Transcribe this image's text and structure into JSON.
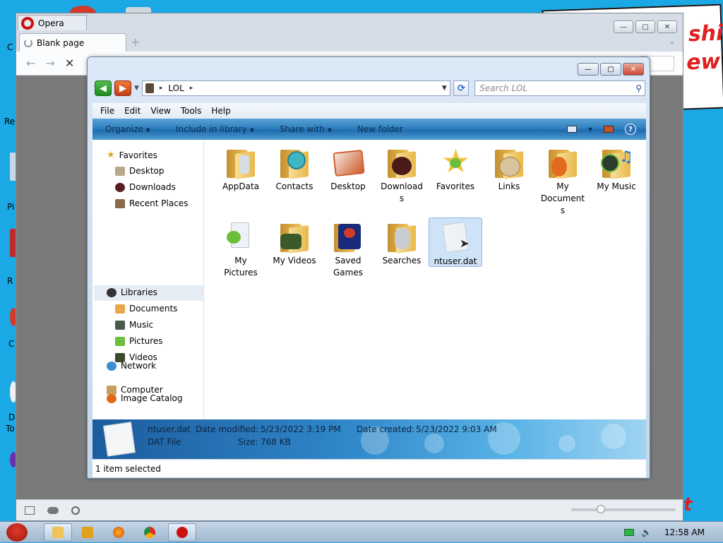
{
  "desktop": {
    "labels": [
      "C",
      "Re",
      "Pi",
      "R",
      "C",
      "D",
      "To"
    ],
    "comic_text_1": "shi",
    "comic_text_2": "ew",
    "comic_text_3": "t"
  },
  "opera": {
    "title": "Opera",
    "tab_label": "Blank page",
    "add_tab": "+",
    "nav": {
      "back": "←",
      "forward": "→",
      "stop": "✕"
    },
    "win_buttons": {
      "minimize": "—",
      "maximize": "▢",
      "close": "✕"
    },
    "tab_menu_chevron": "⌄"
  },
  "explorer": {
    "win_buttons": {
      "minimize": "—",
      "maximize": "▢",
      "close": "✕"
    },
    "address": {
      "segment": "LOL",
      "separator": "▸"
    },
    "search": {
      "placeholder": "Search LOL"
    },
    "menu": [
      "File",
      "Edit",
      "View",
      "Tools",
      "Help"
    ],
    "commands": [
      "Organize",
      "Include in library",
      "Share with",
      "New folder"
    ],
    "nav_pane": {
      "favorites": "Favorites",
      "favorites_items": [
        "Desktop",
        "Downloads",
        "Recent Places"
      ],
      "libraries": "Libraries",
      "libraries_items": [
        "Documents",
        "Music",
        "Pictures",
        "Videos"
      ],
      "computer": "Computer",
      "network": "Network",
      "image_catalog": "Image Catalog"
    },
    "files": [
      {
        "line1": "AppData",
        "line2": "",
        "line3": "",
        "color": "#7a8a9a"
      },
      {
        "line1": "Contacts",
        "line2": "",
        "line3": "",
        "color": "#3fb5c2"
      },
      {
        "line1": "Desktop",
        "line2": "",
        "line3": "",
        "color": "#cf5b2a"
      },
      {
        "line1": "Download",
        "line2": "s",
        "line3": "",
        "color": "#4a1a1a"
      },
      {
        "line1": "Favorites",
        "line2": "",
        "line3": "",
        "color": "#f3c33c"
      },
      {
        "line1": "Links",
        "line2": "",
        "line3": "",
        "color": "#b8915a"
      },
      {
        "line1": "My",
        "line2": "Document",
        "line3": "s",
        "color": "#e36a1e"
      },
      {
        "line1": "My Music",
        "line2": "",
        "line3": "",
        "color": "#2d6b2d"
      },
      {
        "line1": "My",
        "line2": "Pictures",
        "line3": "",
        "color": "#6cbf3c"
      },
      {
        "line1": "My Videos",
        "line2": "",
        "line3": "",
        "color": "#3a5a2a"
      },
      {
        "line1": "Saved",
        "line2": "Games",
        "line3": "",
        "color": "#1a2a7a"
      },
      {
        "line1": "Searches",
        "line2": "",
        "line3": "",
        "color": "#c9ccd0"
      },
      {
        "line1": "ntuser.dat",
        "line2": "",
        "line3": "",
        "color": "#eef2f6"
      }
    ],
    "details": {
      "name": "ntuser.dat",
      "type": "DAT File",
      "modified_label": "Date modified:",
      "modified_value": "5/23/2022 3:19 PM",
      "created_label": "Date created:",
      "created_value": "5/23/2022 9:03 AM",
      "size_label": "Size:",
      "size_value": "768 KB"
    },
    "status": "1 item selected"
  },
  "taskbar": {
    "clock": "12:58 AM",
    "tray_icons": [
      "battery-icon",
      "speaker-icon"
    ]
  }
}
